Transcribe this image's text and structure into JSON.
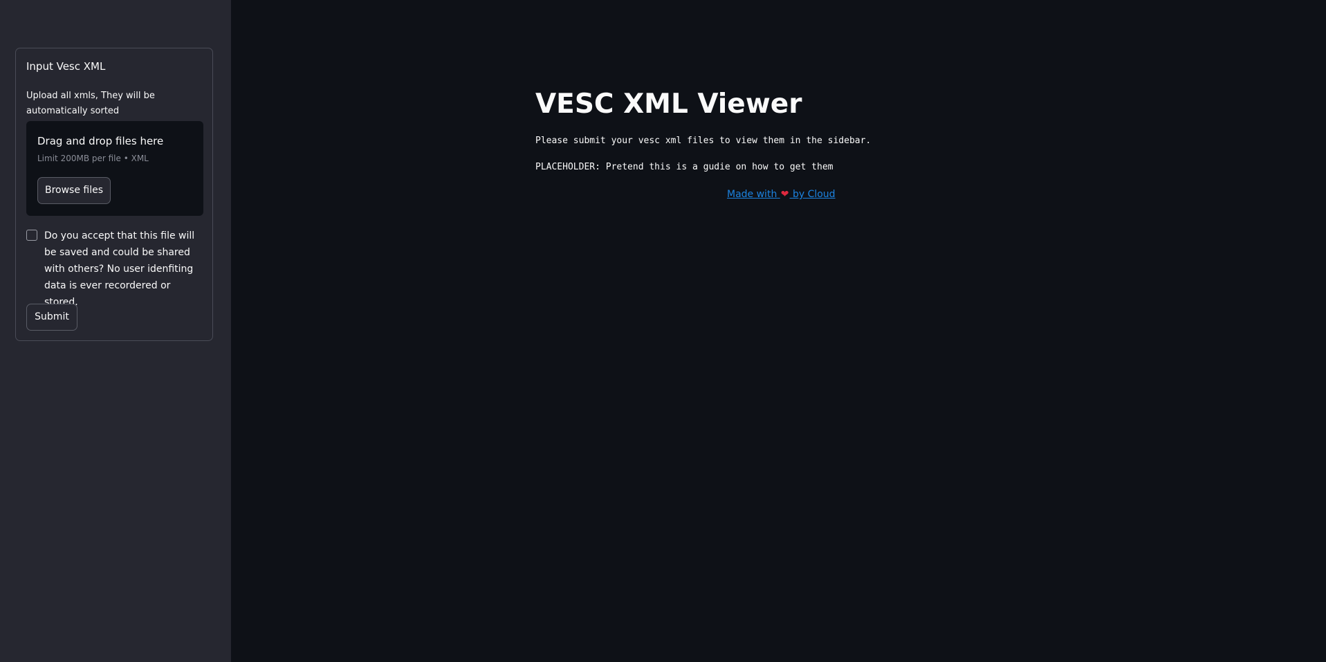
{
  "sidebar": {
    "form": {
      "title": "Input Vesc XML",
      "upload_label": "Upload all xmls, They will be automatically sorted",
      "dropzone": {
        "title": "Drag and drop files here",
        "limit": "Limit 200MB per file • XML",
        "browse_label": "Browse files"
      },
      "consent": {
        "checked": false,
        "label": "Do you accept that this file will be saved and could be shared with others? No user idenfiting data is ever recordered or stored."
      },
      "submit_label": "Submit"
    }
  },
  "main": {
    "title": "VESC XML Viewer",
    "lines": [
      "Please submit your vesc xml files to view them in the sidebar.",
      "PLACEHOLDER: Pretend this is a gudie on how to get them"
    ],
    "footer": {
      "made_with": "Made with",
      "heart_icon": "heart-icon",
      "by": "by Cloud"
    }
  },
  "colors": {
    "background": "#0e1117",
    "sidebar": "#262730",
    "link": "#1c83e1",
    "heart": "#e0293f"
  }
}
